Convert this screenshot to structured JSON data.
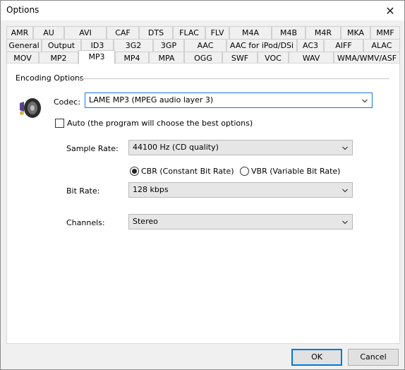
{
  "window": {
    "title": "Options"
  },
  "tabs": {
    "row1": [
      "AMR",
      "AU",
      "AVI",
      "CAF",
      "DTS",
      "FLAC",
      "FLV",
      "M4A",
      "M4B",
      "M4R",
      "MKA",
      "MMF"
    ],
    "row2": [
      "General",
      "Output",
      "ID3",
      "3G2",
      "3GP",
      "AAC",
      "AAC for iPod/DSi",
      "AC3",
      "AIFF",
      "ALAC"
    ],
    "row3": [
      "MOV",
      "MP2",
      "MP3",
      "MP4",
      "MPA",
      "OGG",
      "SWF",
      "VOC",
      "WAV",
      "WMA/WMV/ASF"
    ],
    "active": "MP3"
  },
  "encoding": {
    "group_title": "Encoding Options",
    "codec_label": "Codec:",
    "codec_value": "LAME MP3 (MPEG audio layer 3)",
    "auto_label": "Auto (the program will choose the best options)",
    "auto_checked": false,
    "sample_rate_label": "Sample Rate:",
    "sample_rate_value": "44100 Hz (CD quality)",
    "cbr_label": "CBR (Constant Bit Rate)",
    "vbr_label": "VBR (Variable Bit Rate)",
    "bitrate_mode": "CBR",
    "bit_rate_label": "Bit Rate:",
    "bit_rate_value": "128 kbps",
    "channels_label": "Channels:",
    "channels_value": "Stereo"
  },
  "buttons": {
    "ok": "OK",
    "cancel": "Cancel"
  },
  "icons": {
    "close": "close-icon",
    "speaker": "speaker-icon",
    "chevron": "chevron-down-icon"
  },
  "colors": {
    "accent": "#0078d7",
    "window_bg": "#f0f0f0",
    "panel_bg": "#ffffff"
  }
}
